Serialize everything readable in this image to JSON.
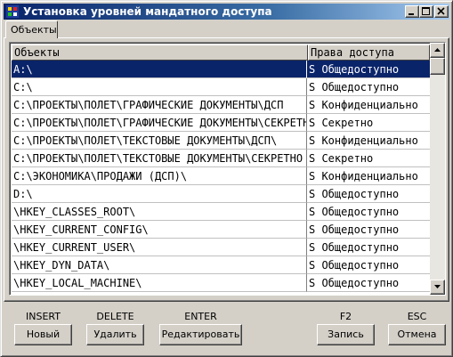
{
  "window": {
    "title": "Установка уровней мандатного доступа"
  },
  "tabs": [
    {
      "label": "Объекты"
    }
  ],
  "grid": {
    "columns": [
      "Объекты",
      "Права доступа"
    ],
    "selected_row": 0,
    "rows": [
      {
        "object": "A:\\",
        "access": "S Общедоступно"
      },
      {
        "object": "C:\\",
        "access": "S Общедоступно"
      },
      {
        "object": "C:\\ПРОЕКТЫ\\ПОЛЕТ\\ГРАФИЧЕСКИЕ ДОКУМЕНТЫ\\ДСП",
        "access": "S Конфиденциально"
      },
      {
        "object": "C:\\ПРОЕКТЫ\\ПОЛЕТ\\ГРАФИЧЕСКИЕ ДОКУМЕНТЫ\\СЕКРЕТНО",
        "access": "S Секретно"
      },
      {
        "object": "C:\\ПРОЕКТЫ\\ПОЛЕТ\\ТЕКСТОВЫЕ ДОКУМЕНТЫ\\ДСП\\",
        "access": "S Конфиденциально"
      },
      {
        "object": "C:\\ПРОЕКТЫ\\ПОЛЕТ\\ТЕКСТОВЫЕ ДОКУМЕНТЫ\\СЕКРЕТНО",
        "access": "S Секретно"
      },
      {
        "object": "C:\\ЭКОНОМИКА\\ПРОДАЖИ (ДСП)\\",
        "access": "S Конфиденциально"
      },
      {
        "object": "D:\\",
        "access": "S Общедоступно"
      },
      {
        "object": "\\HKEY_CLASSES_ROOT\\",
        "access": "S Общедоступно"
      },
      {
        "object": "\\HKEY_CURRENT_CONFIG\\",
        "access": "S Общедоступно"
      },
      {
        "object": "\\HKEY_CURRENT_USER\\",
        "access": "S Общедоступно"
      },
      {
        "object": "\\HKEY_DYN_DATA\\",
        "access": "S Общедоступно"
      },
      {
        "object": "\\HKEY_LOCAL_MACHINE\\",
        "access": "S Общедоступно"
      }
    ]
  },
  "actions": [
    {
      "hotkey": "INSERT",
      "label": "Новый"
    },
    {
      "hotkey": "DELETE",
      "label": "Удалить"
    },
    {
      "hotkey": "ENTER",
      "label": "Редактировать"
    },
    {
      "hotkey": "F2",
      "label": "Запись"
    },
    {
      "hotkey": "ESC",
      "label": "Отмена"
    }
  ],
  "colors": {
    "selection": "#0a246a",
    "face": "#d4d0c8"
  },
  "icons": {
    "app": "app-icon",
    "minimize": "minimize-icon",
    "maximize": "maximize-icon",
    "close": "close-icon"
  }
}
